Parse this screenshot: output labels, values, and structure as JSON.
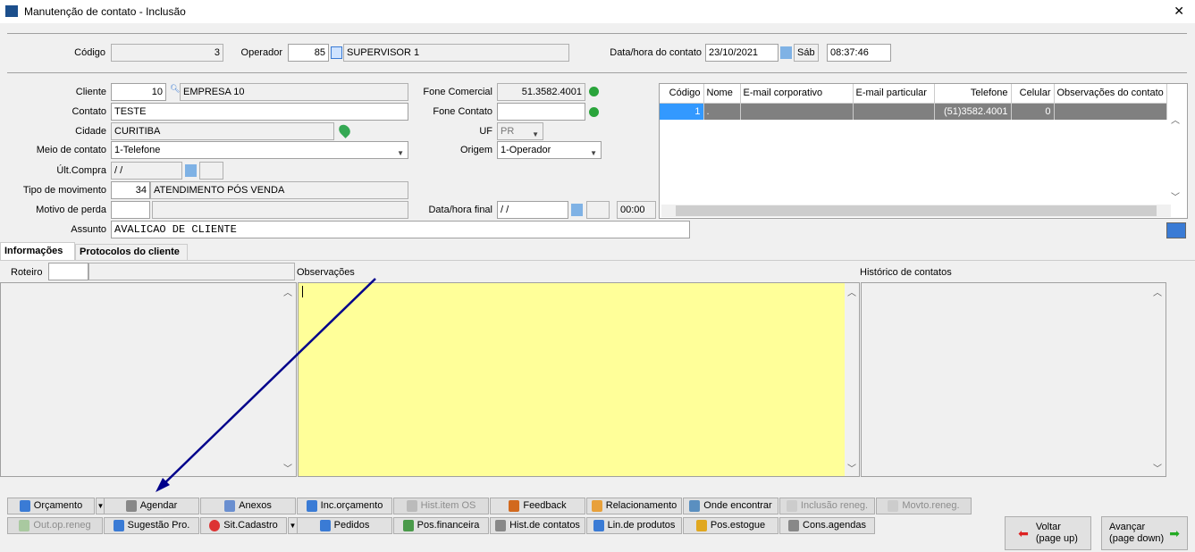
{
  "window": {
    "title": "Manutenção de contato - Inclusão",
    "close": "✕"
  },
  "header": {
    "codigo_label": "Código",
    "codigo": "3",
    "operador_label": "Operador",
    "operador": "85",
    "operador_nome": "SUPERVISOR 1",
    "datahora_label": "Data/hora do contato",
    "data": "23/10/2021",
    "dia": "Sáb",
    "hora": "08:37:46"
  },
  "form": {
    "cliente_label": "Cliente",
    "cliente": "10",
    "cliente_nome": "EMPRESA 10",
    "contato_label": "Contato",
    "contato": "TESTE",
    "cidade_label": "Cidade",
    "cidade": "CURITIBA",
    "meio_label": "Meio de contato",
    "meio": "1-Telefone",
    "ultcompra_label": "Últ.Compra",
    "ultcompra": " / /",
    "tipo_label": "Tipo de movimento",
    "tipo": "34",
    "tipo_nome": "ATENDIMENTO PÓS VENDA",
    "motivo_label": "Motivo de perda",
    "assunto_label": "Assunto",
    "assunto": "AVALICAO DE CLIENTE",
    "fone_com_label": "Fone Comercial",
    "fone_com": "51.3582.4001",
    "fone_cont_label": "Fone Contato",
    "uf_label": "UF",
    "uf": "PR",
    "origem_label": "Origem",
    "origem": "1-Operador",
    "datafinal_label": "Data/hora final",
    "datafinal": " / /",
    "horafinal": "00:00"
  },
  "grid": {
    "columns": [
      "Código",
      "Nome",
      "E-mail corporativo",
      "E-mail particular",
      "Telefone",
      "Celular",
      "Observações do contato"
    ],
    "rows": [
      [
        "1",
        ".",
        "",
        "",
        "(51)3582.4001",
        "0",
        ""
      ]
    ]
  },
  "tabs": [
    {
      "label": "Informações"
    },
    {
      "label": "Protocolos do cliente"
    }
  ],
  "panels": {
    "roteiro_label": "Roteiro",
    "obs_label": "Observações",
    "hist_label": "Histórico de contatos"
  },
  "buttons_row1": [
    "Orçamento",
    "Agendar",
    "Anexos",
    "Inc.orçamento",
    "Hist.item OS",
    "Feedback",
    "Relacionamento",
    "Onde encontrar",
    "Inclusão reneg.",
    "Movto.reneg."
  ],
  "buttons_row2": [
    "Out.op.reneg",
    "Sugestão Pro.",
    "Sit.Cadastro",
    "Pedidos",
    "Pos.financeira",
    "Hist.de contatos",
    "Lin.de produtos",
    "Pos.estogue",
    "Cons.agendas"
  ],
  "nav": {
    "voltar": "Voltar",
    "voltar_sub": "(page up)",
    "avancar": "Avançar",
    "avancar_sub": "(page down)"
  },
  "colors": {
    "obs_bg": "#ffff99",
    "selected_row": "#808080",
    "selected_cell": "#3399ff",
    "arrow": "#00008b"
  }
}
